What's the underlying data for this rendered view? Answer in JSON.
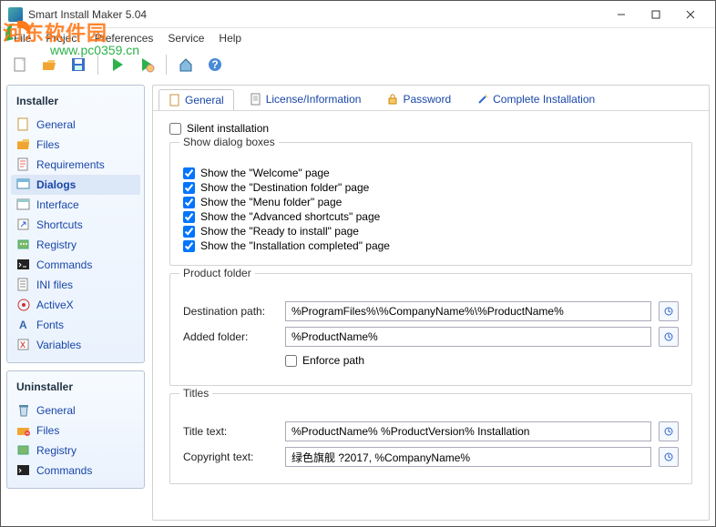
{
  "window": {
    "title": "Smart Install Maker 5.04"
  },
  "menu": {
    "file": "File",
    "project": "Project",
    "preferences": "Preferences",
    "service": "Service",
    "help": "Help"
  },
  "watermark": {
    "text": "河东软件园",
    "url": "www.pc0359.cn"
  },
  "sidebar": {
    "installer": {
      "title": "Installer",
      "items": [
        {
          "label": "General"
        },
        {
          "label": "Files"
        },
        {
          "label": "Requirements"
        },
        {
          "label": "Dialogs"
        },
        {
          "label": "Interface"
        },
        {
          "label": "Shortcuts"
        },
        {
          "label": "Registry"
        },
        {
          "label": "Commands"
        },
        {
          "label": "INI files"
        },
        {
          "label": "ActiveX"
        },
        {
          "label": "Fonts"
        },
        {
          "label": "Variables"
        }
      ]
    },
    "uninstaller": {
      "title": "Uninstaller",
      "items": [
        {
          "label": "General"
        },
        {
          "label": "Files"
        },
        {
          "label": "Registry"
        },
        {
          "label": "Commands"
        }
      ]
    }
  },
  "tabs": {
    "general": "General",
    "license": "License/Information",
    "password": "Password",
    "complete": "Complete Installation"
  },
  "dialogs": {
    "silent": "Silent installation",
    "show_group": "Show dialog boxes",
    "welcome": "Show the \"Welcome\" page",
    "dest": "Show the \"Destination folder\" page",
    "menu": "Show the \"Menu folder\" page",
    "adv": "Show the \"Advanced shortcuts\" page",
    "ready": "Show the \"Ready to install\" page",
    "done": "Show the \"Installation completed\" page"
  },
  "product_folder": {
    "title": "Product folder",
    "dest_label": "Destination path:",
    "dest_value": "%ProgramFiles%\\%CompanyName%\\%ProductName%",
    "added_label": "Added folder:",
    "added_value": "%ProductName%",
    "enforce": "Enforce path"
  },
  "titles": {
    "title": "Titles",
    "title_label": "Title text:",
    "title_value": "%ProductName% %ProductVersion% Installation",
    "copyright_label": "Copyright text:",
    "copyright_value": "绿色旗舰 ?2017, %CompanyName%"
  }
}
